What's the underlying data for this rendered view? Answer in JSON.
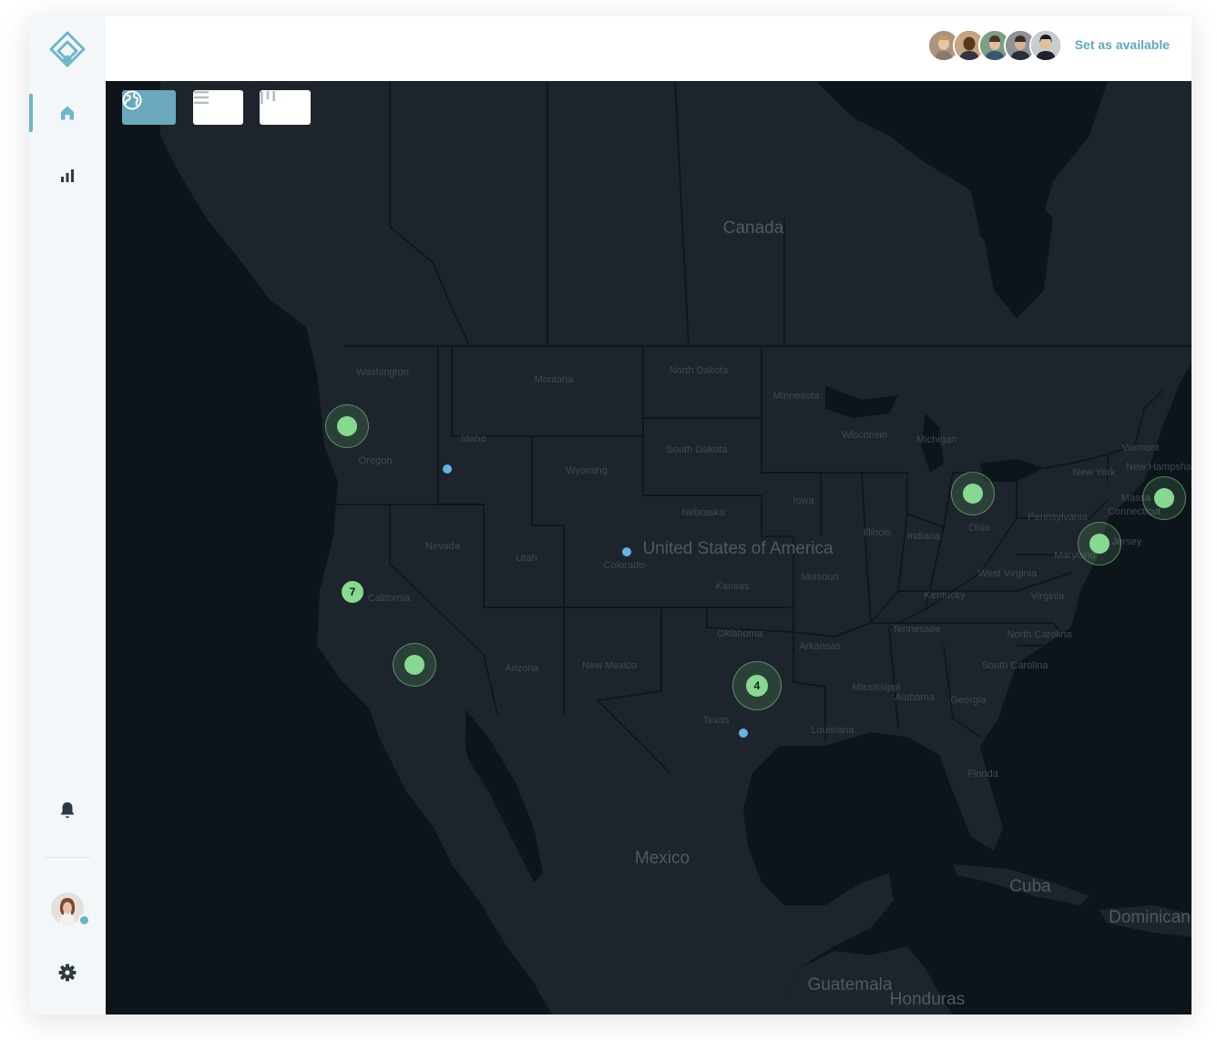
{
  "app": {
    "brand_color": "#6fb6c9",
    "accent_available": "#5fa8bf"
  },
  "sidebar": {
    "logo": "logo-icon",
    "items": [
      {
        "name": "home",
        "icon": "home-icon",
        "active": true
      },
      {
        "name": "analytics",
        "icon": "bar-chart-icon",
        "active": false
      }
    ],
    "bottom": [
      {
        "name": "notifications",
        "icon": "bell-icon"
      },
      {
        "name": "profile",
        "icon": "avatar",
        "status": "online"
      },
      {
        "name": "settings",
        "icon": "gear-icon"
      }
    ]
  },
  "header": {
    "team_avatars": [
      "avatar-1",
      "avatar-2",
      "avatar-3",
      "avatar-4",
      "avatar-5"
    ],
    "set_available_label": "Set as available"
  },
  "view_toggle": {
    "options": [
      {
        "name": "map",
        "icon": "globe-icon",
        "active": true
      },
      {
        "name": "list",
        "icon": "list-icon",
        "active": false
      },
      {
        "name": "board",
        "icon": "columns-icon",
        "active": false
      }
    ]
  },
  "map": {
    "countries": {
      "canada": "Canada",
      "usa": "United States of America",
      "mexico": "Mexico",
      "cuba": "Cuba",
      "dominican": "Dominican",
      "guatemala": "Guatemala",
      "honduras": "Honduras"
    },
    "states": {
      "washington": "Washington",
      "oregon": "Oregon",
      "idaho": "Idaho",
      "montana": "Montana",
      "wyoming": "Wyoming",
      "north_dakota": "North Dakota",
      "south_dakota": "South Dakota",
      "nebraska": "Nebraska",
      "minnesota": "Minnesota",
      "iowa": "Iowa",
      "wisconsin": "Wisconsin",
      "michigan": "Michigan",
      "illinois": "Illinois",
      "indiana": "Indiana",
      "ohio": "Ohio",
      "nevada": "Nevada",
      "utah": "Utah",
      "colorado": "Colorado",
      "california": "California",
      "kansas": "Kansas",
      "missouri": "Missouri",
      "kentucky": "Kentucky",
      "west_virginia": "West Virginia",
      "virginia": "Virginia",
      "pennsylvania": "Pennsylvania",
      "new_york": "New York",
      "vermont": "Vermont",
      "new_hampshire": "New Hampsha",
      "connecticut": "Connecticut",
      "massachusetts": "Massa",
      "maryland": "Maryland",
      "new_jersey": "Jersey",
      "tennessee": "Tennessee",
      "north_carolina": "North Carolina",
      "south_carolina": "South Carolina",
      "oklahoma": "Oklahoma",
      "arkansas": "Arkansas",
      "arizona": "Arizona",
      "new_mexico": "New Mexico",
      "texas": "Texas",
      "louisiana": "Louisiana",
      "mississippi": "Mississippi",
      "alabama": "Alabama",
      "georgia": "Georgia",
      "florida": "Florida"
    },
    "clusters": [
      {
        "id": "cluster-oregon",
        "count": ""
      },
      {
        "id": "cluster-california-north",
        "count": "7"
      },
      {
        "id": "cluster-california-south",
        "count": ""
      },
      {
        "id": "cluster-texas",
        "count": "4"
      },
      {
        "id": "cluster-ohio",
        "count": ""
      },
      {
        "id": "cluster-maryland",
        "count": ""
      },
      {
        "id": "cluster-new-england",
        "count": ""
      }
    ],
    "pins": [
      "pin-idaho",
      "pin-colorado",
      "pin-texas"
    ],
    "cluster_color": "#87d98f",
    "pin_color": "#64b5e4"
  }
}
